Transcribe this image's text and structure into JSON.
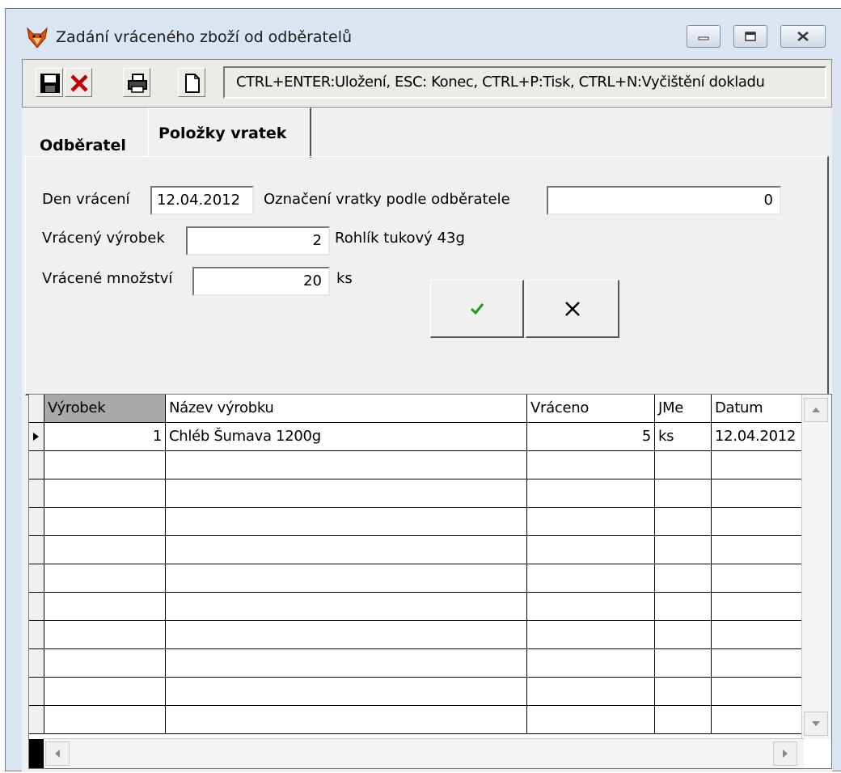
{
  "window": {
    "title": "Zadání vráceného zboží od odběratelů",
    "buttons": [
      "minimize",
      "maximize",
      "close"
    ]
  },
  "toolbar": {
    "icons": [
      "save-icon",
      "delete-icon",
      "print-icon",
      "new-document-icon"
    ],
    "hint": "CTRL+ENTER:Uložení, ESC: Konec, CTRL+P:Tisk, CTRL+N:Vyčištění dokladu"
  },
  "tabs": [
    {
      "label": "Odběratel"
    },
    {
      "label": "Položky vratek"
    }
  ],
  "form": {
    "return_day_label": "Den vrácení",
    "return_day_value": "12.04.2012",
    "customer_mark_label": "Označení vratky podle odběratele",
    "customer_mark_value": "0",
    "product_label": "Vrácený výrobek",
    "product_value": "2",
    "product_name": "Rohlík tukový 43g",
    "quantity_label": "Vrácené množství",
    "quantity_value": "20",
    "quantity_unit": "ks"
  },
  "grid": {
    "columns": [
      "Výrobek",
      "Název výrobku",
      "Vráceno",
      "JMe",
      "Datum"
    ],
    "rows": [
      {
        "product": "1",
        "name": "Chléb Šumava 1200g",
        "returned": "5",
        "unit": "ks",
        "date": "12.04.2012"
      }
    ]
  }
}
